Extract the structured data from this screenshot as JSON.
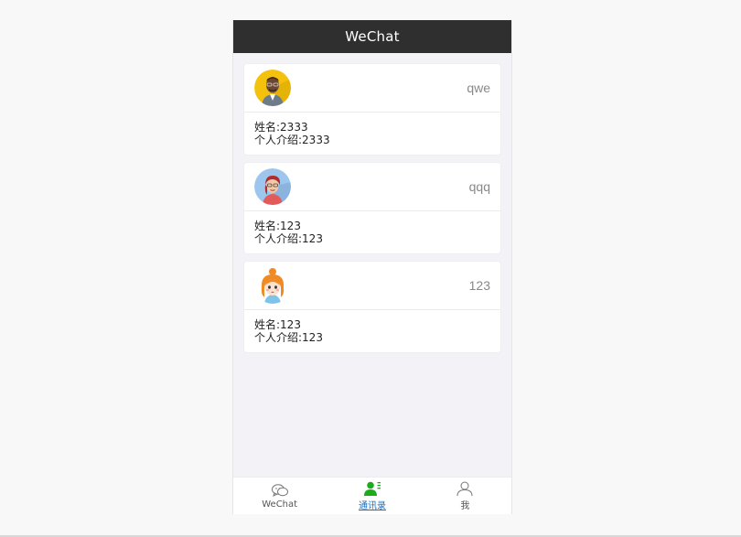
{
  "app": {
    "title": "WeChat"
  },
  "contacts": [
    {
      "nickname": "qwe",
      "name_label": "姓名:",
      "name": "2333",
      "intro_label": "个人介绍:",
      "intro": "2333",
      "avatar": "man-glasses-avatar"
    },
    {
      "nickname": "qqq",
      "name_label": "姓名:",
      "name": "123",
      "intro_label": "个人介绍:",
      "intro": "123",
      "avatar": "woman-red-hair-avatar"
    },
    {
      "nickname": "123",
      "name_label": "姓名:",
      "name": "123",
      "intro_label": "个人介绍:",
      "intro": "123",
      "avatar": "girl-orange-hair-avatar"
    }
  ],
  "tabs": [
    {
      "label": "WeChat",
      "icon": "chat-bubbles-icon",
      "active": false
    },
    {
      "label": "通讯录",
      "icon": "contacts-icon",
      "active": true
    },
    {
      "label": "我",
      "icon": "person-icon",
      "active": false
    }
  ],
  "colors": {
    "titlebar": "#2f2f2f",
    "accent": "#1aad19",
    "link": "#1a6fbf"
  }
}
